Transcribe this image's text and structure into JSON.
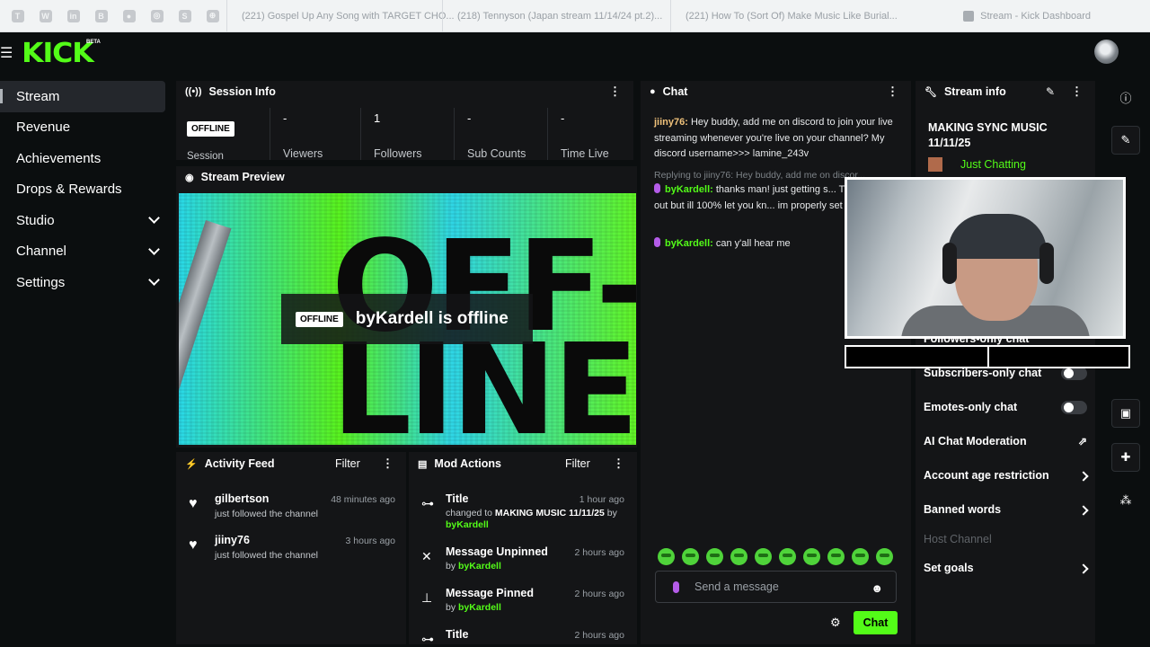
{
  "browser": {
    "pinned": [
      "T",
      "W",
      "in",
      "B",
      "●",
      "◎",
      "S",
      "⊕"
    ],
    "tabs": [
      "(221) Gospel Up Any Song with TARGET CHO...",
      "(218) Tennyson (Japan stream 11/14/24 pt.2)...",
      "(221) How To (Sort Of) Make Music Like Burial..."
    ],
    "active_tab": "Stream - Kick Dashboard"
  },
  "header": {
    "logo": "KICK",
    "beta": "BETA"
  },
  "sidebar": {
    "items": [
      {
        "label": "Stream"
      },
      {
        "label": "Revenue"
      },
      {
        "label": "Achievements"
      },
      {
        "label": "Drops & Rewards"
      },
      {
        "label": "Studio"
      },
      {
        "label": "Channel"
      },
      {
        "label": "Settings"
      }
    ]
  },
  "session": {
    "title": "Session Info",
    "status": "OFFLINE",
    "label": "Session",
    "stats": [
      {
        "value": "-",
        "label": "Viewers"
      },
      {
        "value": "1",
        "label": "Followers"
      },
      {
        "value": "-",
        "label": "Sub Counts"
      },
      {
        "value": "-",
        "label": "Time Live"
      }
    ]
  },
  "preview": {
    "title": "Stream Preview",
    "big_top": "OFF-",
    "big_bottom": "LINE",
    "badge": "OFFLINE",
    "message": "byKardell is offline"
  },
  "activity": {
    "title": "Activity Feed",
    "filter": "Filter",
    "items": [
      {
        "name": "gilbertson",
        "text": "just followed the channel",
        "time": "48 minutes ago"
      },
      {
        "name": "jiiny76",
        "text": "just followed the channel",
        "time": "3 hours ago"
      }
    ]
  },
  "mod": {
    "title": "Mod Actions",
    "filter": "Filter",
    "items": [
      {
        "name": "Title",
        "time": "1 hour ago",
        "prefix": "changed to",
        "detail": "MAKING MUSIC 11/11/25",
        "by": "by",
        "user": "byKardell"
      },
      {
        "name": "Message Unpinned",
        "time": "2 hours ago",
        "by": "by",
        "user": "byKardell"
      },
      {
        "name": "Message Pinned",
        "time": "2 hours ago",
        "by": "by",
        "user": "byKardell"
      },
      {
        "name": "Title",
        "time": "2 hours ago"
      }
    ]
  },
  "chat": {
    "title": "Chat",
    "messages": [
      {
        "user": "jiiny76:",
        "text": "Hey buddy, add me on discord to join your live streaming whenever you're live on your channel? My discord username>>> lamine_243v"
      },
      {
        "reply": "Replying to jiiny76: Hey buddy, add me on discor..."
      },
      {
        "user": "byKardell:",
        "text": "thanks man! just getting s... Tryna figure it out but ill 100% let you kn... im properly set up"
      },
      {
        "user": "byKardell:",
        "text": "can y'all hear me"
      }
    ],
    "placeholder": "Send a message",
    "send": "Chat"
  },
  "info": {
    "title": "Stream info",
    "stream_title": "MAKING SYNC MUSIC 11/11/25",
    "category": "Just Chatting",
    "rows": [
      {
        "label": "Followers-only chat"
      },
      {
        "label": "Subscribers-only chat"
      },
      {
        "label": "Emotes-only chat"
      },
      {
        "label": "AI Chat Moderation"
      },
      {
        "label": "Account age restriction"
      },
      {
        "label": "Banned words"
      },
      {
        "label": "Host Channel"
      },
      {
        "label": "Set goals"
      }
    ]
  },
  "colors": {
    "accent": "#53fc18",
    "bg": "#0b0e0f",
    "panel": "#141517"
  }
}
